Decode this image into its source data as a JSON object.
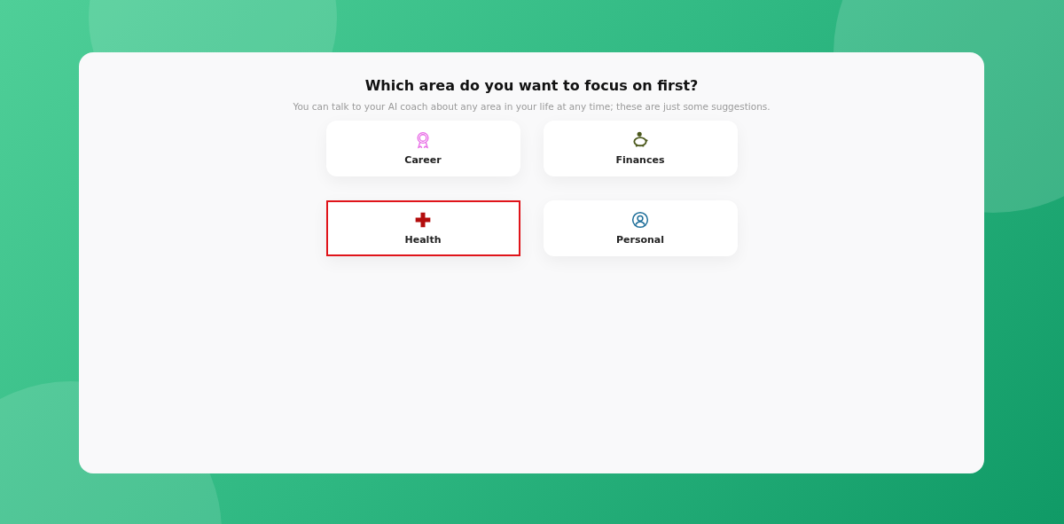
{
  "title": "Which area do you want to focus on first?",
  "subtitle": "You can talk to your AI coach about any area in your life at any time; these are just some suggestions.",
  "areas": [
    {
      "label": "Career",
      "kind": "award",
      "color": "#e86be6",
      "selected": false
    },
    {
      "label": "Finances",
      "kind": "piggy",
      "color": "#4d5a1e",
      "selected": false
    },
    {
      "label": "Health",
      "kind": "cross",
      "color": "#b30d0d",
      "selected": true
    },
    {
      "label": "Personal",
      "kind": "person",
      "color": "#1f6f9a",
      "selected": false
    }
  ]
}
